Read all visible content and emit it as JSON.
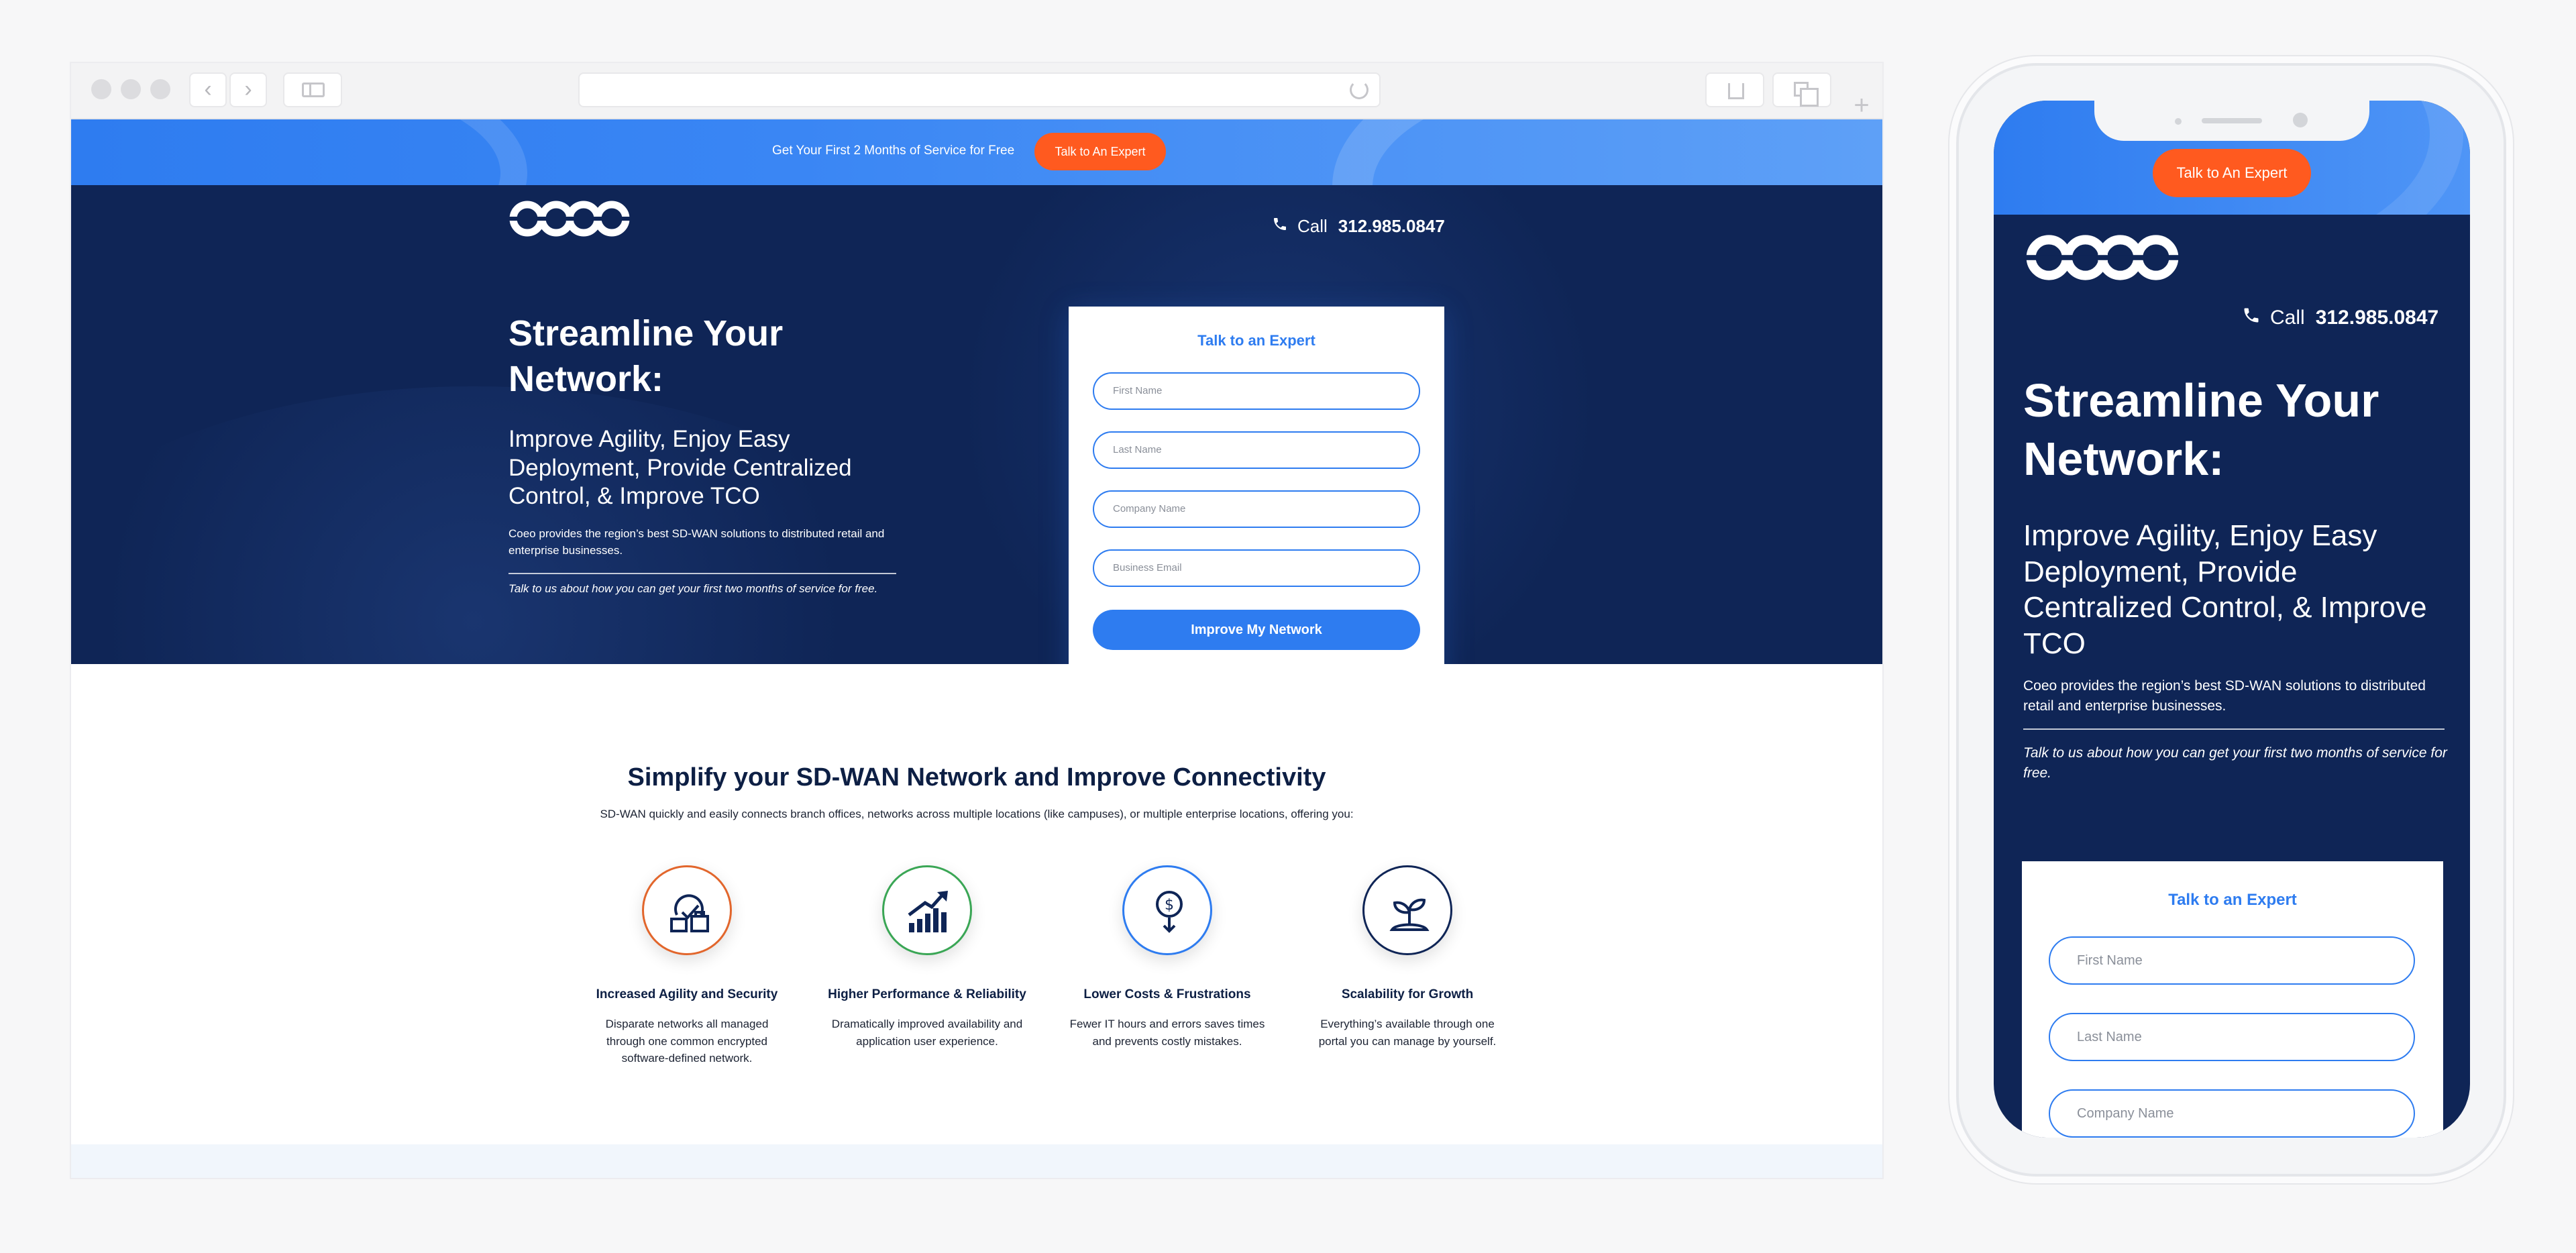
{
  "colors": {
    "brand_blue": "#2e7cf0",
    "navy": "#0f2556",
    "orange": "#ff5a1f",
    "text_dark": "#0d1f44"
  },
  "promo": {
    "text": "Get Your First 2 Months of Service for Free",
    "cta": "Talk to An Expert"
  },
  "header": {
    "logo": "coeo",
    "call_label": "Call",
    "phone": "312.985.0847"
  },
  "hero": {
    "title": "Streamline Your Network:",
    "subtitle": "Improve Agility, Enjoy Easy Deployment, Provide Centralized Control, & Improve TCO",
    "description": "Coeo provides the region’s best SD-WAN solutions to distributed retail and enterprise businesses.",
    "note": "Talk to us about how you can get your first two months of service for free."
  },
  "form": {
    "title": "Talk to an Expert",
    "fields": [
      {
        "placeholder": "First Name"
      },
      {
        "placeholder": "Last Name"
      },
      {
        "placeholder": "Company Name"
      },
      {
        "placeholder": "Business Email"
      }
    ],
    "submit": "Improve My Network"
  },
  "features_section": {
    "title": "Simplify your SD-WAN Network and Improve Connectivity",
    "description": "SD-WAN quickly and easily connects branch offices, networks across multiple locations (like campuses), or multiple enterprise locations, offering you:",
    "items": [
      {
        "icon": "security-icon",
        "ring_color": "#e2662c",
        "title": "Increased Agility and Security",
        "text": "Disparate networks all managed through one common encrypted software-defined network."
      },
      {
        "icon": "growth-chart-icon",
        "ring_color": "#3aa655",
        "title": "Higher Performance & Reliability",
        "text": "Dramatically improved availability and application user experience."
      },
      {
        "icon": "cost-down-icon",
        "ring_color": "#2e7cf0",
        "title": "Lower Costs & Frustrations",
        "text": "Fewer IT hours and errors saves times and prevents costly mistakes."
      },
      {
        "icon": "sprout-icon",
        "ring_color": "#0f2556",
        "title": "Scalability for Growth",
        "text": "Everything’s available through one portal you can manage by yourself."
      }
    ]
  },
  "mobile": {
    "cta": "Talk to An Expert",
    "call_label": "Call",
    "phone": "312.985.0847",
    "title": "Streamline Your Network:",
    "subtitle": "Improve Agility, Enjoy Easy Deployment, Provide Centralized Control, & Improve TCO",
    "description": "Coeo provides the region’s best SD-WAN solutions to distributed retail and enterprise businesses.",
    "note": "Talk to us about how you can get your first two months of service for free.",
    "form_title": "Talk to an Expert",
    "fields": [
      {
        "placeholder": "First Name"
      },
      {
        "placeholder": "Last Name"
      },
      {
        "placeholder": "Company Name"
      }
    ]
  }
}
